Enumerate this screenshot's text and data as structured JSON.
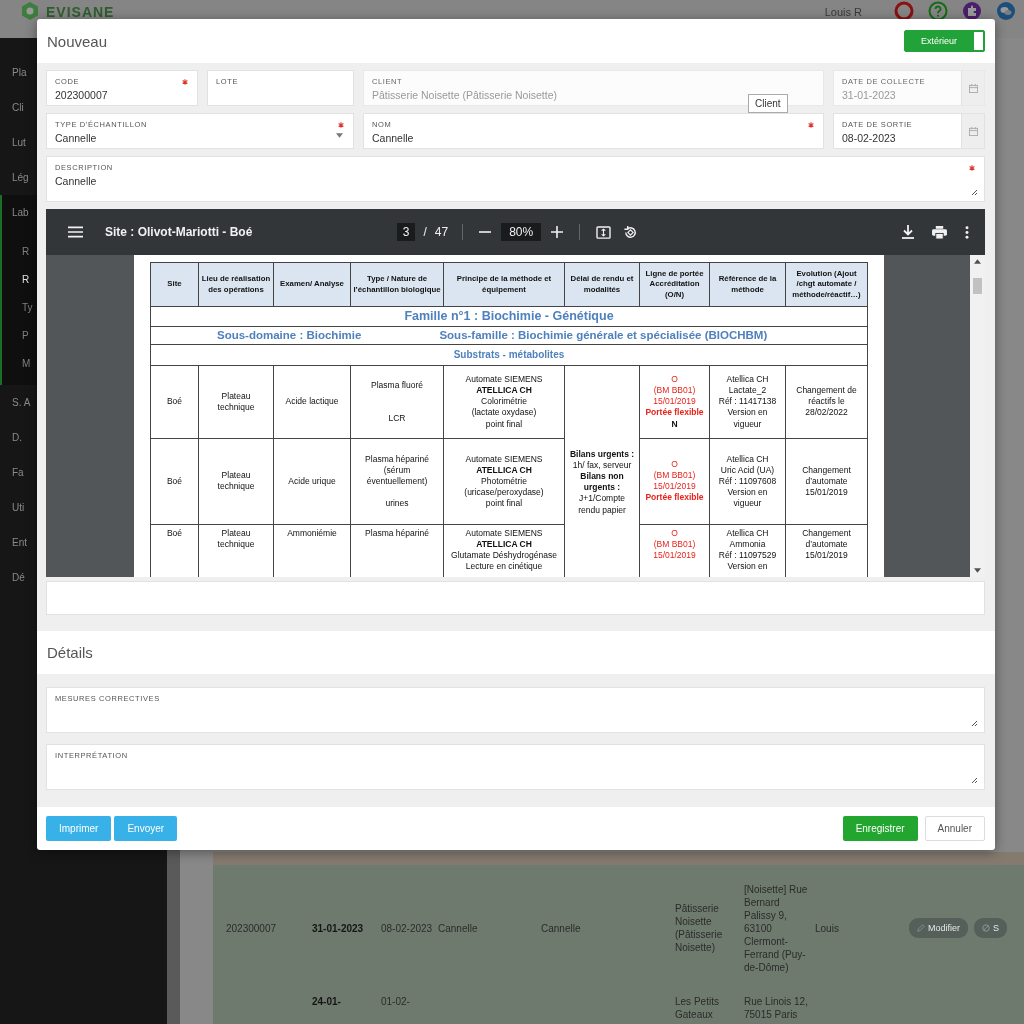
{
  "app_header": {
    "logo_text": "EVISANE",
    "user": "Louis R"
  },
  "sidebar": {
    "items": [
      {
        "label": "Pla",
        "selected": false
      },
      {
        "label": "Cli",
        "selected": false
      },
      {
        "label": "Lut",
        "selected": false
      },
      {
        "label": "Lég",
        "selected": false
      },
      {
        "label": "Lab",
        "selected": false,
        "children": [
          {
            "label": "R",
            "selected": false
          },
          {
            "label": "R",
            "selected": true
          },
          {
            "label": "Ty",
            "selected": false
          },
          {
            "label": "P",
            "selected": false
          },
          {
            "label": "M",
            "selected": false
          }
        ]
      },
      {
        "label": "S. A",
        "selected": false
      },
      {
        "label": "D.",
        "selected": false
      },
      {
        "label": "Fa",
        "selected": false
      },
      {
        "label": "Uti",
        "selected": false
      },
      {
        "label": "Ent",
        "selected": false
      },
      {
        "label": "Dé",
        "selected": false
      }
    ]
  },
  "background_table": {
    "rows": [
      {
        "cells": [
          "202300007",
          "31-01-2023",
          "08-02-2023",
          "Cannelle",
          "Cannelle",
          "Pâtisserie Noisette (Pâtisserie Noisette)",
          "[Noisette] Rue Bernard Palissy 9, 63100 Clermont-Ferrand (Puy-de-Dôme)",
          "Louis"
        ],
        "actions": [
          {
            "label": "Modifier",
            "kind": "edit"
          },
          {
            "label": "S",
            "kind": "ban"
          }
        ]
      },
      {
        "cells": [
          null,
          "24-01-",
          "01-02-",
          null,
          null,
          "Les Petits Gateaux",
          "Rue Linois 12, 75015 Paris",
          null
        ]
      }
    ]
  },
  "modal": {
    "title": "Nouveau",
    "toggle": {
      "label": "Extérieur",
      "on": true
    },
    "fields": [
      {
        "kind": "input",
        "label": "CODE",
        "value": "202300007",
        "required": true,
        "disabled": false
      },
      {
        "kind": "input",
        "label": "LOTE",
        "required": false,
        "disabled": false
      },
      {
        "kind": "input",
        "label": "CLIENT",
        "value": "Pâtisserie Noisette (Pâtisserie Noisette)",
        "required": false,
        "disabled": true
      },
      {
        "kind": "date",
        "label": "DATE DE COLLECTE",
        "value": "31-01-2023",
        "required": false,
        "disabled": true
      },
      {
        "kind": "select",
        "label": "TYPE D’ÉCHANTILLON",
        "value": "Cannelle",
        "required": true,
        "disabled": false
      },
      {
        "kind": "input",
        "label": "NOM",
        "value": "Cannelle",
        "required": true,
        "disabled": false
      },
      {
        "kind": "date",
        "label": "DATE DE SORTIE",
        "value": "08-02-2023",
        "required": false,
        "disabled": false
      },
      {
        "kind": "textarea",
        "label": "DESCRIPTION",
        "value": "Cannelle",
        "required": true,
        "disabled": false
      }
    ],
    "tooltip": "Client",
    "viewer": {
      "title": "Site : Olivot-Mariotti - Boé",
      "page": "3",
      "page_separator": "/",
      "page_count": "47",
      "zoom": "80%",
      "table": {
        "headers": [
          "Site",
          "Lieu de réalisation des opérations",
          "Examen/ Analyse",
          "Type / Nature de l’échantillon biologique",
          "Principe de la méthode et équipement",
          "Délai de rendu et modalités",
          "Ligne de portée Accréditation (O/N)",
          "Référence de la méthode",
          "Evolution (Ajout /chgt automate / méthode/réactif…)"
        ],
        "family": "Famille n°1 : Biochimie - Génétique",
        "subdomain": [
          "Sous-domaine : Biochimie",
          "Sous-famille : Biochimie générale et spécialisée (BIOCHBM)"
        ],
        "section": "Substrats - métabolites",
        "shared_cell": "**Bilans urgents :**\n1h/ fax, serveur\n**Bilans non**\n**urgents :**\nJ+1/Compte\nrendu papier",
        "rows": [
          {
            "cells": [
              "Boé",
              "Plateau\ntechnique",
              "Acide lactique",
              "Plasma fluoré\n\n\nLCR",
              "Automate SIEMENS\n**ATELLICA CH**\nColorimétrie\n(lactate oxydase)\npoint final"
            ],
            "accreditation": [
              {
                "text": "O",
                "kind": "red"
              },
              {
                "text": "(BM BB01)",
                "kind": "red"
              },
              {
                "text": "15/01/2019",
                "kind": "red"
              },
              {
                "text": "Portée flexible",
                "kind": "red-bold"
              },
              {
                "text": "N",
                "kind": "bold"
              }
            ],
            "reference": "Atellica CH\nLactate_2\nRéf : 11417138\nVersion en\nvigueur",
            "evolution": "Changement de\nréactifs le\n28/02/2022"
          },
          {
            "cells": [
              "Boé",
              "Plateau\ntechnique",
              "Acide urique",
              "Plasma hépariné\n(sérum\néventuellement)\n\nurines",
              "Automate SIEMENS\n**ATELLICA CH**\nPhotométrie\n(uricase/peroxydase)\npoint final"
            ],
            "accreditation": [
              {
                "text": "O",
                "kind": "red"
              },
              {
                "text": "(BM BB01)",
                "kind": "red"
              },
              {
                "text": "15/01/2019",
                "kind": "red"
              },
              {
                "text": "Portée flexible",
                "kind": "red-bold"
              }
            ],
            "reference": "Atellica CH\nUric Acid (UA)\nRéf : 11097608\nVersion en\nvigueur",
            "evolution": "Changement\nd’automate\n15/01/2019"
          },
          {
            "cells": [
              "Boé",
              "Plateau\ntechnique",
              "Ammoniémie",
              "Plasma hépariné",
              "Automate SIEMENS\n**ATELLICA CH**\nGlutamate Déshydrogénase\nLecture en cinétique"
            ],
            "accreditation": [
              {
                "text": "O",
                "kind": "red"
              },
              {
                "text": "(BM BB01)",
                "kind": "red"
              },
              {
                "text": "15/01/2019",
                "kind": "red"
              }
            ],
            "reference": "Atellica CH\nAmmonia\nRéf : 11097529\nVersion en",
            "evolution": "Changement\nd’automate\n15/01/2019"
          }
        ]
      }
    },
    "details": {
      "title": "Détails",
      "fields": [
        {
          "kind": "textarea",
          "label": "MESURES CORRECTIVES",
          "required": false,
          "disabled": false
        },
        {
          "kind": "textarea",
          "label": "INTERPRÉTATION",
          "required": false,
          "disabled": false
        }
      ]
    },
    "buttons": [
      {
        "label": "Imprimer",
        "kind": "info"
      },
      {
        "label": "Envoyer",
        "kind": "info"
      },
      {
        "label": "Enregistrer",
        "kind": "success"
      },
      {
        "label": "Annuler",
        "kind": "default"
      }
    ]
  }
}
